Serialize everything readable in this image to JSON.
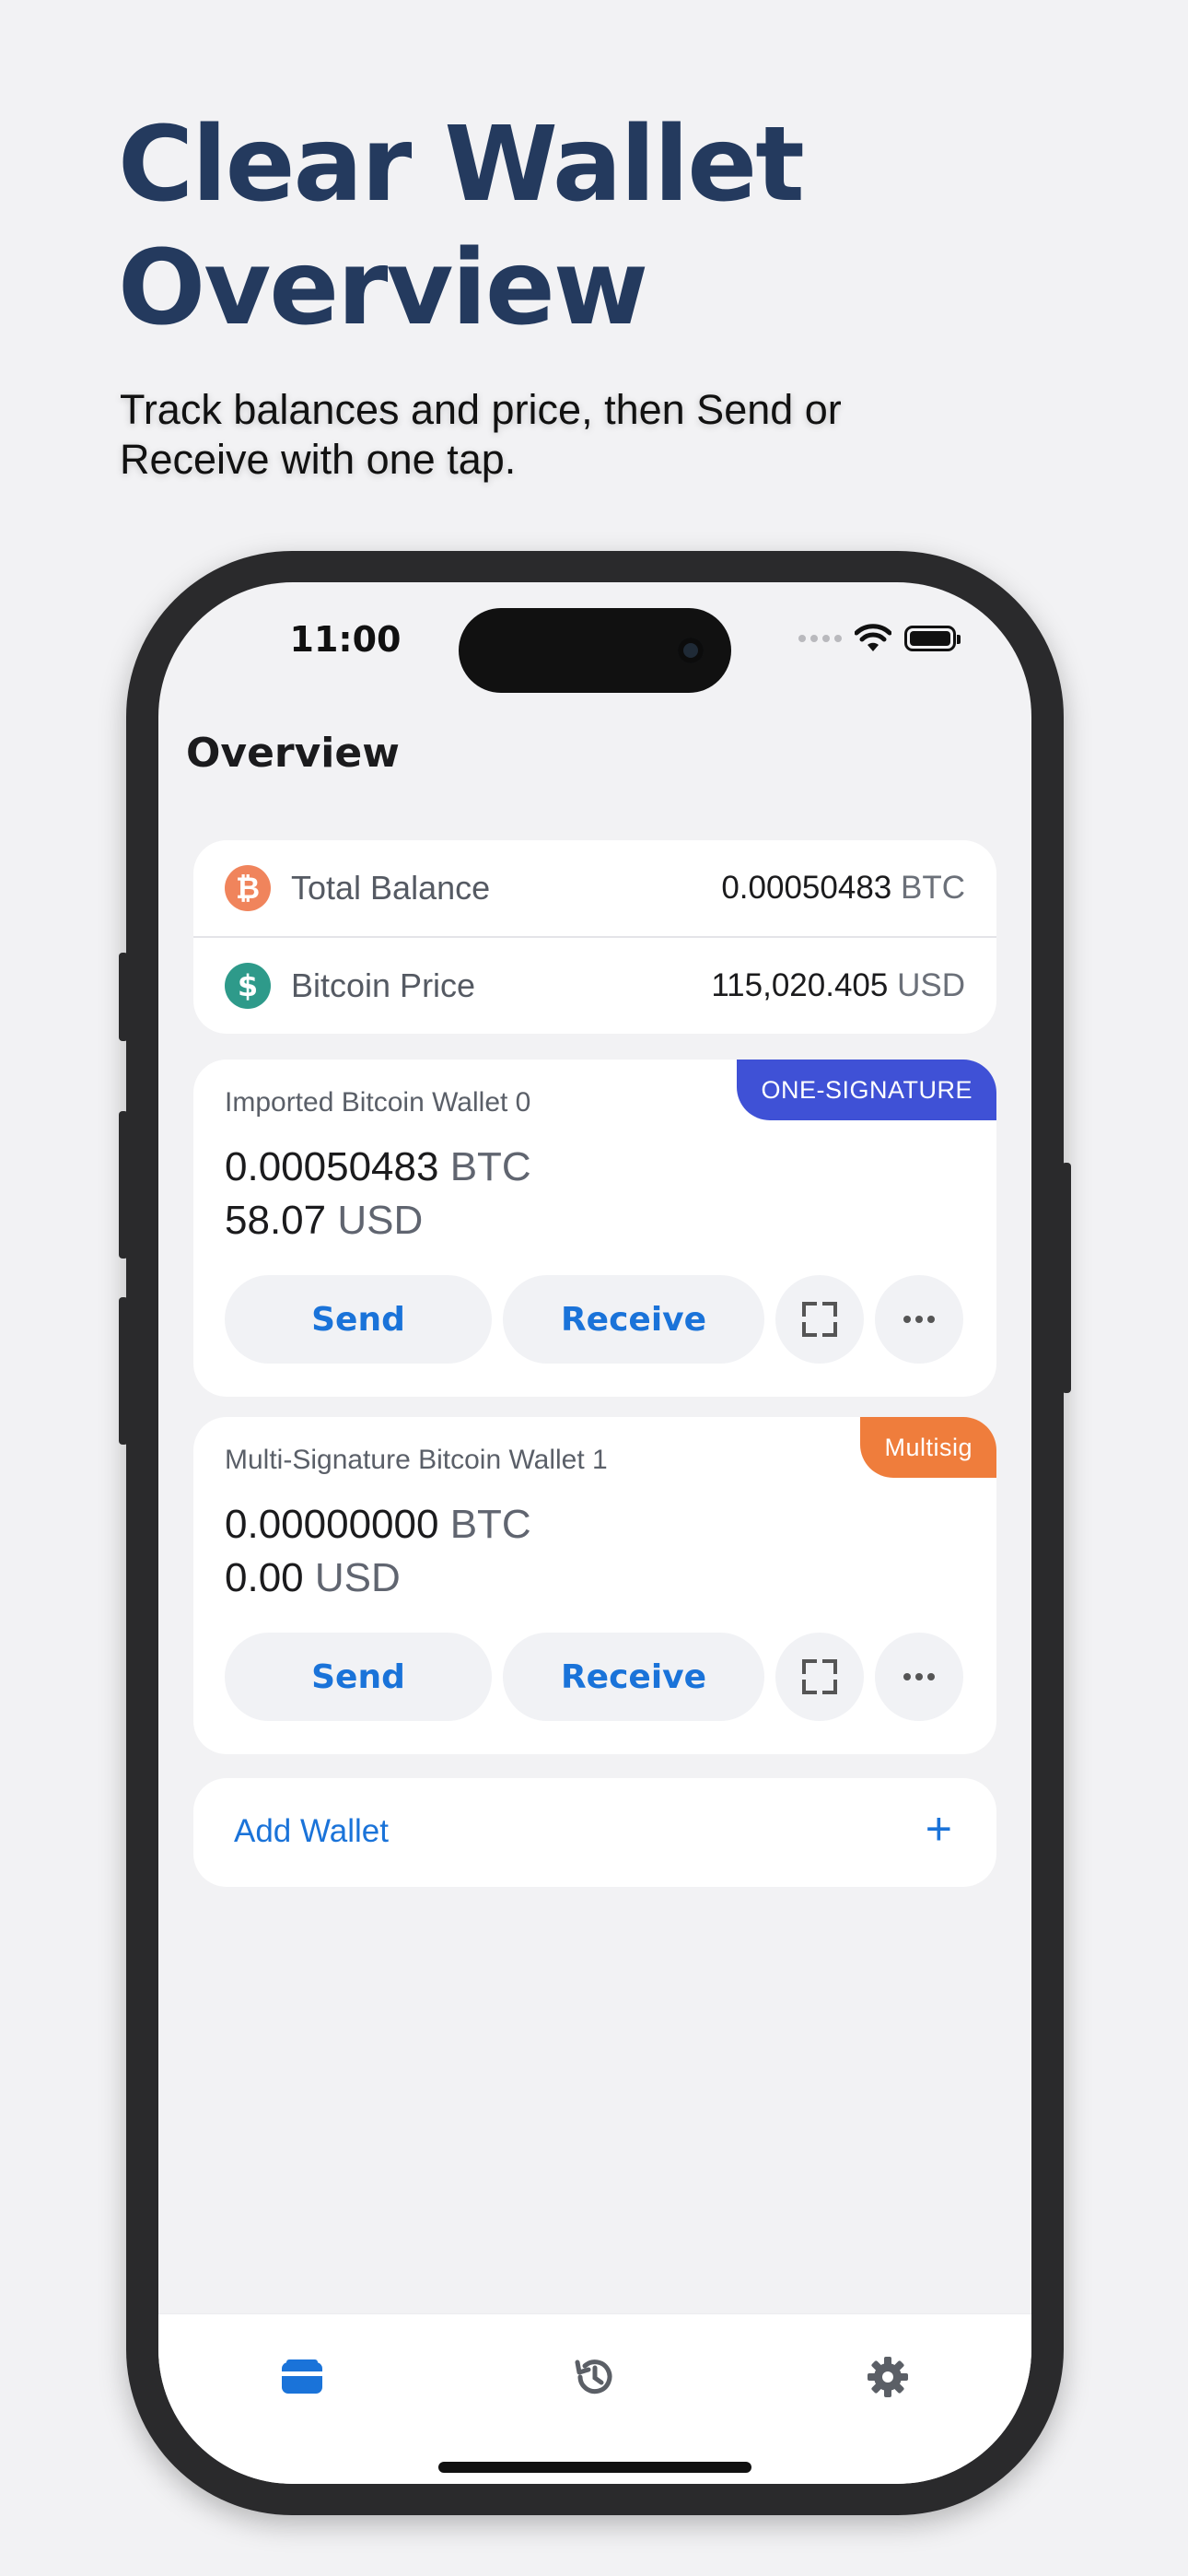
{
  "headline": {
    "line1": "Clear Wallet",
    "line2": "Overview"
  },
  "subline": {
    "line1": "Track balances and price, then Send or",
    "line2": "Receive with one tap."
  },
  "status_bar": {
    "time": "11:00"
  },
  "page_title": "Overview",
  "summary": {
    "total_balance": {
      "label": "Total Balance",
      "value": "0.00050483",
      "unit": "BTC",
      "icon": "bitcoin-icon",
      "color": "#f0845c"
    },
    "bitcoin_price": {
      "label": "Bitcoin Price",
      "value": "115,020.405",
      "unit": "USD",
      "icon": "dollar-icon",
      "color": "#2e9a8a"
    }
  },
  "wallets": [
    {
      "name": "Imported Bitcoin Wallet 0",
      "badge": "ONE-SIGNATURE",
      "badge_color": "#3f51d6",
      "btc_value": "0.00050483",
      "btc_unit": "BTC",
      "usd_value": "58.07",
      "usd_unit": "USD",
      "send_label": "Send",
      "receive_label": "Receive"
    },
    {
      "name": "Multi-Signature Bitcoin Wallet 1",
      "badge": "Multisig",
      "badge_color": "#ef7d3c",
      "btc_value": "0.00000000",
      "btc_unit": "BTC",
      "usd_value": "0.00",
      "usd_unit": "USD",
      "send_label": "Send",
      "receive_label": "Receive"
    }
  ],
  "add_wallet": {
    "label": "Add Wallet",
    "plus": "+"
  },
  "tabbar": {
    "items": [
      {
        "icon": "wallet-icon",
        "active": true
      },
      {
        "icon": "history-icon",
        "active": false
      },
      {
        "icon": "gear-icon",
        "active": false
      }
    ],
    "accent": "#1a73d9"
  }
}
